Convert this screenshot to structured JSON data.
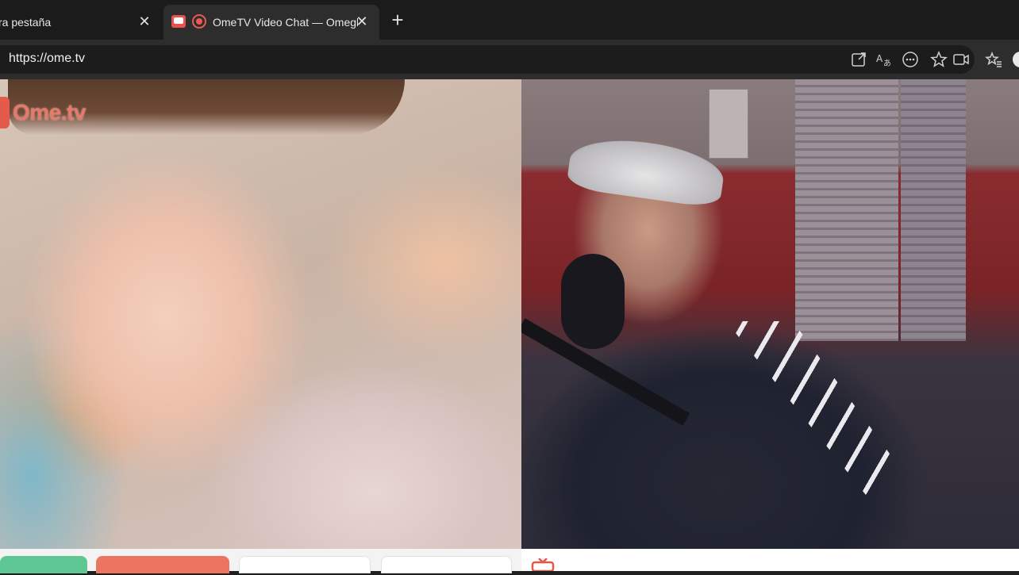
{
  "browser": {
    "tabs": [
      {
        "title": "ra pestaña",
        "active": false
      },
      {
        "title": "OmeTV Video Chat — Omegle",
        "active": true
      }
    ],
    "address": {
      "url": "https://ome.tv"
    },
    "icons": [
      "open-in-app-icon",
      "translate-icon",
      "more-icon",
      "favorite-star-icon",
      "video-camera-icon",
      "favorites-list-icon",
      "profile-icon"
    ]
  },
  "left_panel": {
    "logo_text": "Ome.tv"
  },
  "colors": {
    "start_button": "#5ec794",
    "stop_button": "#ec7562",
    "brand_red": "#e45a4b"
  }
}
